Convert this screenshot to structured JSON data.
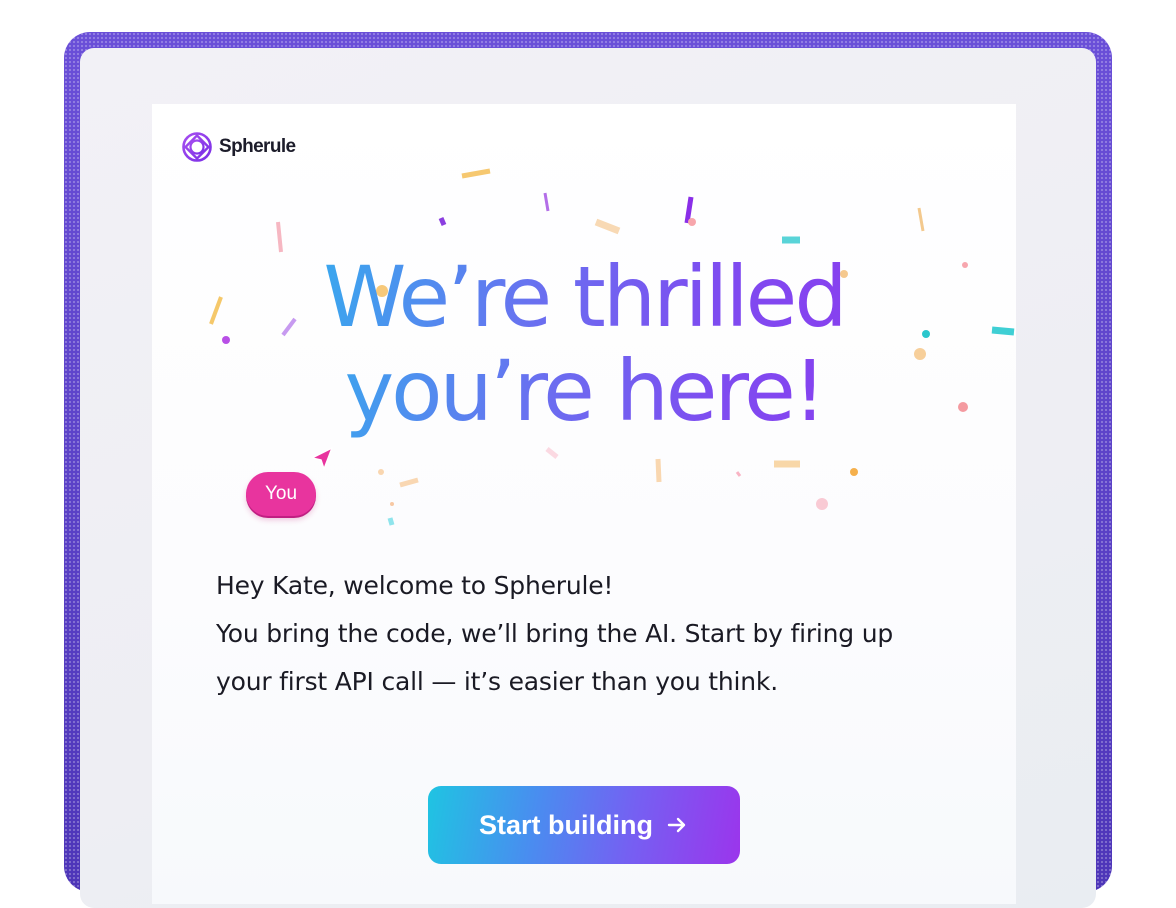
{
  "brand": {
    "name": "Spherule",
    "logo_icon": "sphere-logo-icon",
    "accent": "#9333ea"
  },
  "hero": {
    "headline_line1": "We’re thrilled",
    "headline_line2": "you’re here!",
    "gradient_start": "#1ec8e8",
    "gradient_end": "#9332ee"
  },
  "cursor_tag": {
    "label": "You",
    "color": "#e8349e",
    "icon": "cursor-pointer-icon"
  },
  "message": {
    "greeting": "Hey Kate, welcome to Spherule!",
    "line2": "You bring the code, we’ll bring the AI. Start by firing up",
    "line3": "your first API call — it’s easier than you think."
  },
  "cta": {
    "label": "Start building",
    "icon": "arrow-right-icon"
  }
}
